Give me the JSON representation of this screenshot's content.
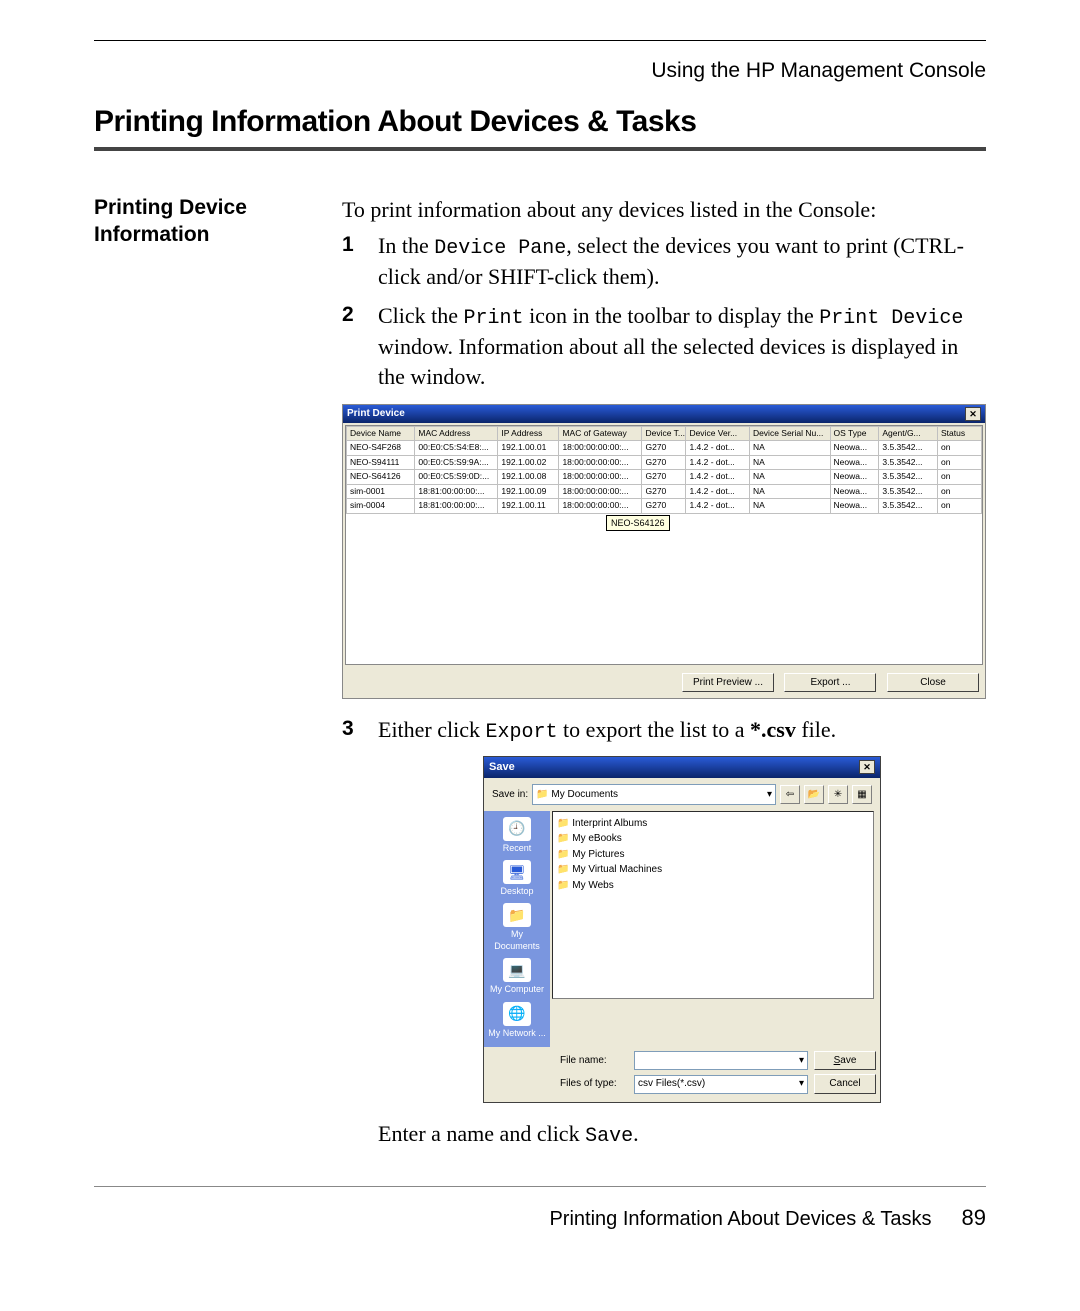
{
  "header": {
    "breadcrumb": "Using the HP Management Console"
  },
  "title": "Printing Information About Devices & Tasks",
  "section": {
    "side_heading": "Printing Device Information",
    "intro": "To print information about any devices listed in the Console:",
    "steps": {
      "1": {
        "num": "1",
        "pre": "In the ",
        "code1": "Device Pane",
        "post": ", select the devices you want to print (CTRL-click and/or SHIFT-click them)."
      },
      "2": {
        "num": "2",
        "pre": "Click the ",
        "code1": "Print",
        "mid": " icon in the toolbar to display the ",
        "code2": "Print Device",
        "post": " window. Information about all the selected devices is displayed in the window."
      },
      "3": {
        "num": "3",
        "pre": "Either click ",
        "code1": "Export",
        "mid": " to export the list to a ",
        "bold": "*.csv",
        "post": " file."
      }
    },
    "closing": {
      "pre": "Enter a name and click ",
      "code": "Save",
      "post": "."
    }
  },
  "print_device": {
    "title": "Print Device",
    "columns": [
      "Device Name",
      "MAC Address",
      "IP Address",
      "MAC of Gateway",
      "Device T...",
      "Device Ver...",
      "Device Serial Nu...",
      "OS Type",
      "Agent/G...",
      "Status"
    ],
    "rows": [
      [
        "NEO-S4F268",
        "00:E0:C5:S4:E8:...",
        "192.1.00.01",
        "18:00:00:00:00:...",
        "G270",
        "1.4.2 - dot...",
        "NA",
        "Neowa...",
        "3.5.3542...",
        "on"
      ],
      [
        "NEO-S94111",
        "00:E0:C5:S9:9A:...",
        "192.1.00.02",
        "18:00:00:00:00:...",
        "G270",
        "1.4.2 - dot...",
        "NA",
        "Neowa...",
        "3.5.3542...",
        "on"
      ],
      [
        "NEO-S64126",
        "00:E0:C5:S9:0D:...",
        "192.1.00.08",
        "18:00:00:00:00:...",
        "G270",
        "1.4.2 - dot...",
        "NA",
        "Neowa...",
        "3.5.3542...",
        "on"
      ],
      [
        "sim-0001",
        "18:81:00:00:00:...",
        "192.1.00.09",
        "18:00:00:00:00:...",
        "G270",
        "1.4.2 - dot...",
        "NA",
        "Neowa...",
        "3.5.3542...",
        "on"
      ],
      [
        "sim-0004",
        "18:81:00:00:00:...",
        "192.1.00.11",
        "18:00:00:00:00:...",
        "G270",
        "1.4.2 - dot...",
        "NA",
        "Neowa...",
        "3.5.3542...",
        "on"
      ]
    ],
    "tooltip": "NEO-S64126",
    "buttons": {
      "preview": "Print Preview ...",
      "export": "Export ...",
      "close": "Close"
    }
  },
  "save_dialog": {
    "title": "Save",
    "save_in_label": "Save in:",
    "save_in_value": "My Documents",
    "places": [
      "Recent",
      "Desktop",
      "My Documents",
      "My Computer",
      "My Network ..."
    ],
    "folders": [
      "Interprint Albums",
      "My eBooks",
      "My Pictures",
      "My Virtual Machines",
      "My Webs"
    ],
    "file_name_label": "File name:",
    "file_name_value": "",
    "file_type_label": "Files of type:",
    "file_type_value": "csv Files(*.csv)",
    "save_btn": "Save",
    "cancel_btn": "Cancel"
  },
  "footer": {
    "text": "Printing Information About Devices & Tasks",
    "page": "89"
  }
}
